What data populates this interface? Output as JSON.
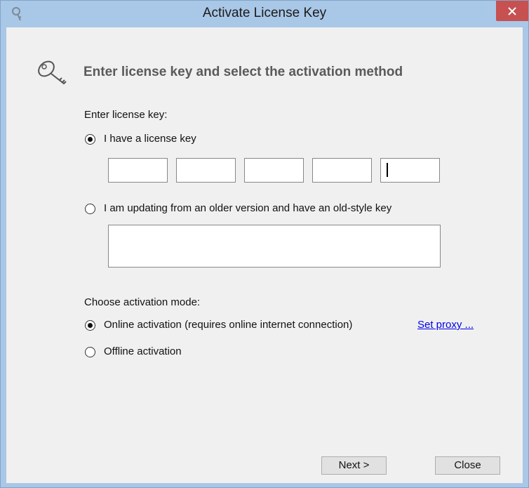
{
  "window": {
    "title": "Activate License Key"
  },
  "header": {
    "heading": "Enter license key and select the activation method",
    "icon": "key-icon"
  },
  "license": {
    "section_label": "Enter license key:",
    "option_new_label": "I have a license key",
    "option_new_checked": true,
    "key_fields": [
      "",
      "",
      "",
      "",
      ""
    ],
    "option_old_label": "I am updating from an older version and have an old-style key",
    "option_old_checked": false,
    "old_key_value": ""
  },
  "activation": {
    "section_label": "Choose activation mode:",
    "online_label": "Online activation (requires online internet connection)",
    "online_checked": true,
    "proxy_link": "Set proxy ...",
    "offline_label": "Offline activation",
    "offline_checked": false
  },
  "buttons": {
    "next_label": "Next >",
    "close_label": "Close"
  },
  "colors": {
    "titlebar": "#a9c7e6",
    "close_button": "#c75050",
    "link": "#0000ee"
  }
}
